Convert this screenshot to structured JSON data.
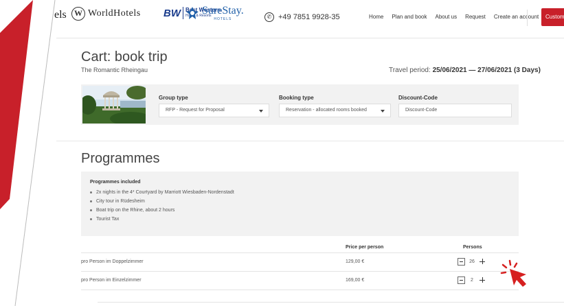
{
  "header": {
    "cut_text": "els",
    "brand_worldhotels": "WorldHotels",
    "brand_bw": "BW",
    "brand_bestwestern": "Best Western.",
    "brand_bestwestern_sub": "Hotels & Resorts",
    "brand_surestay": "SureStay.",
    "brand_surestay_sub": "HOTELS",
    "phone": "+49 7851 9928-35",
    "nav": [
      "Home",
      "Plan and book",
      "About us",
      "Request",
      "Create an account"
    ],
    "customer_button": "Customer L"
  },
  "cart": {
    "title": "Cart: book trip",
    "subtitle": "The Romantic Rheingau",
    "travel_period_label": "Travel period:",
    "travel_period_value": "25/06/2021 — 27/06/2021 (3 Days)",
    "group_type_label": "Group type",
    "group_type_value": "RFP - Request for Proposal",
    "booking_type_label": "Booking type",
    "booking_type_value": "Reservation - allocated rooms booked",
    "discount_label": "Discount-Code",
    "discount_placeholder": "Discount-Code"
  },
  "programmes": {
    "title": "Programmes",
    "included_heading": "Programmes included",
    "items": [
      "2x nights in the 4* Courtyard by Marriott Wiesbaden-Nordenstadt",
      "City tour in Rüdesheim",
      "Boat trip on the Rhine, about 2 hours",
      "Tourist Tax"
    ]
  },
  "pricing": {
    "col_price": "Price per person",
    "col_persons": "Persons",
    "rows": [
      {
        "label": "pro Person im Doppelzimmer",
        "price": "129,00 €",
        "persons": "26"
      },
      {
        "label": "pro Person im Einzelzimmer",
        "price": "169,00 €",
        "persons": "2"
      }
    ]
  },
  "colors": {
    "accent_red": "#c8202a",
    "panel_gray": "#f2f2f2"
  }
}
